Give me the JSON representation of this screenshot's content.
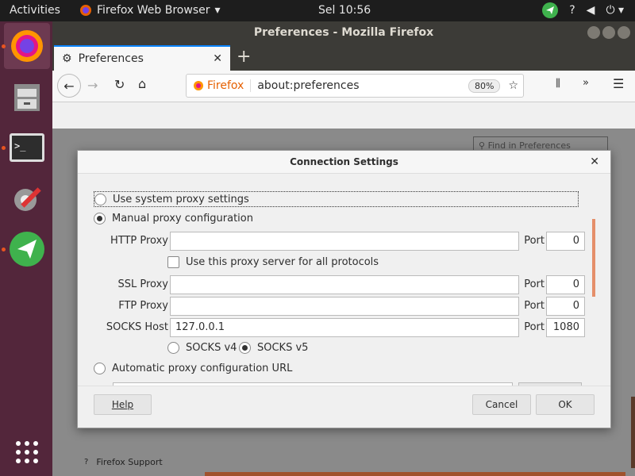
{
  "topbar": {
    "activities": "Activities",
    "app_name": "Firefox Web Browser",
    "clock": "Sel 10:56"
  },
  "window": {
    "title": "Preferences - Mozilla Firefox"
  },
  "tab": {
    "label": "Preferences"
  },
  "urlbar": {
    "identity": "Firefox",
    "url": "about:preferences",
    "zoom": "80%"
  },
  "preferences": {
    "find_placeholder": "Find in Preferences",
    "support_link": "Firefox Support"
  },
  "dialog": {
    "title": "Connection Settings",
    "system_proxy": "Use system proxy settings",
    "manual_proxy": "Manual proxy configuration",
    "http_label": "HTTP Proxy",
    "http_value": "",
    "http_port_label": "Port",
    "http_port": "0",
    "all_protocols": "Use this proxy server for all protocols",
    "ssl_label": "SSL Proxy",
    "ssl_value": "",
    "ssl_port_label": "Port",
    "ssl_port": "0",
    "ftp_label": "FTP Proxy",
    "ftp_value": "",
    "ftp_port_label": "Port",
    "ftp_port": "0",
    "socks_label": "SOCKS Host",
    "socks_value": "127.0.0.1",
    "socks_port_label": "Port",
    "socks_port": "1080",
    "socks_v4": "SOCKS v4",
    "socks_v5": "SOCKS v5",
    "auto_proxy": "Automatic proxy configuration URL",
    "help_button": "Help",
    "cancel_button": "Cancel",
    "ok_button": "OK"
  },
  "colors": {
    "accent": "#e95420",
    "dock": "#53263b",
    "titlebar": "#3c3b37"
  }
}
